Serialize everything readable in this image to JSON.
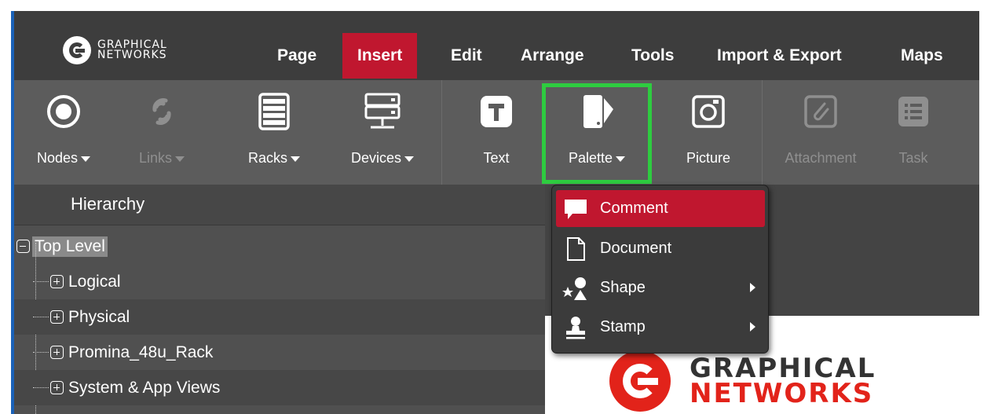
{
  "logo": {
    "line1": "GRAPHICAL",
    "line2": "NETWORKS"
  },
  "menu": [
    {
      "label": "Page"
    },
    {
      "label": "Insert",
      "active": true
    },
    {
      "label": "Edit"
    },
    {
      "label": "Arrange"
    },
    {
      "label": "Tools"
    },
    {
      "label": "Import & Export"
    },
    {
      "label": "Maps"
    }
  ],
  "toolbar": {
    "nodes": {
      "label": "Nodes",
      "icon": "nodes-icon"
    },
    "links": {
      "label": "Links",
      "icon": "links-icon",
      "disabled": true
    },
    "racks": {
      "label": "Racks",
      "icon": "rack-icon"
    },
    "devices": {
      "label": "Devices",
      "icon": "device-icon"
    },
    "text": {
      "label": "Text",
      "icon": "text-icon"
    },
    "palette": {
      "label": "Palette",
      "icon": "palette-icon"
    },
    "picture": {
      "label": "Picture",
      "icon": "camera-icon"
    },
    "attachment": {
      "label": "Attachment",
      "icon": "paperclip-icon",
      "disabled": true
    },
    "task": {
      "label": "Task",
      "icon": "task-list-icon",
      "disabled": true
    }
  },
  "hierarchy": {
    "title": "Hierarchy",
    "root": {
      "label": "Top Level",
      "selected": true
    },
    "children": [
      {
        "label": "Logical"
      },
      {
        "label": "Physical"
      },
      {
        "label": "Promina_48u_Rack"
      },
      {
        "label": "System & App Views"
      }
    ]
  },
  "palette_menu": {
    "items": [
      {
        "label": "Comment",
        "icon": "comment-icon",
        "highlighted": true
      },
      {
        "label": "Document",
        "icon": "document-icon"
      },
      {
        "label": "Shape",
        "icon": "shape-icon",
        "submenu": true
      },
      {
        "label": "Stamp",
        "icon": "stamp-icon",
        "submenu": true
      }
    ]
  },
  "canvas_logo": {
    "line1": "GRAPHICAL",
    "line2": "NETWORKS"
  },
  "colors": {
    "accent": "#c0172f",
    "highlight_box": "#2ecc40",
    "menubar": "#3d3d3d",
    "toolbar": "#5c5c5c"
  }
}
